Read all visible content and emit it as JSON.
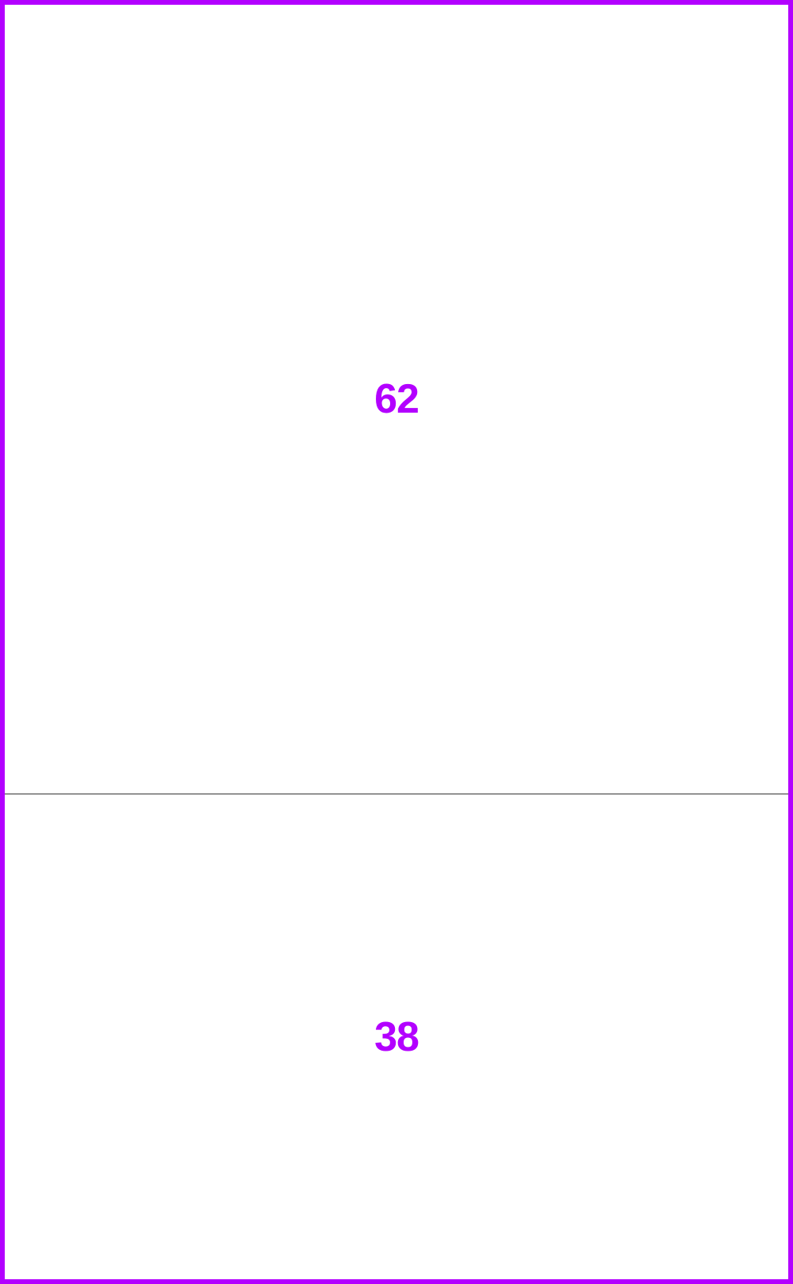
{
  "colors": {
    "accent": "#b300ff",
    "divider": "#333333",
    "background": "#ffffff"
  },
  "sections": [
    {
      "value": "62",
      "proportion": 62
    },
    {
      "value": "38",
      "proportion": 38
    }
  ]
}
